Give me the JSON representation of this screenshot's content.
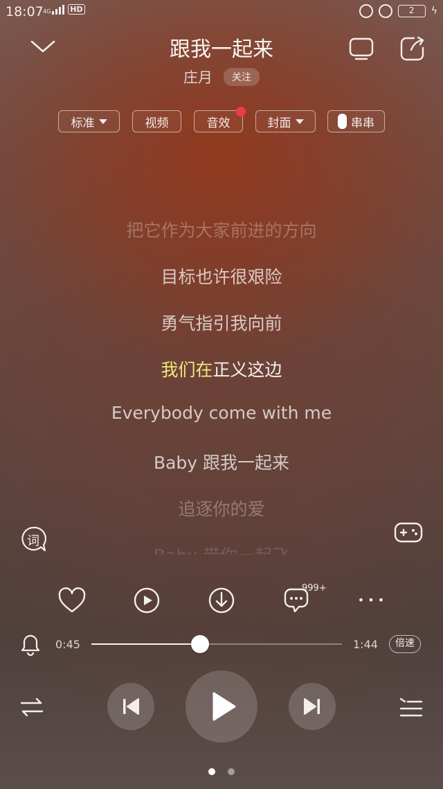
{
  "status_bar": {
    "time": "18:07",
    "network": "4G",
    "hd": "HD",
    "battery": "2"
  },
  "header": {
    "title": "跟我一起来",
    "artist": "庄月",
    "follow_label": "关注"
  },
  "chips": {
    "quality": "标准",
    "video": "视频",
    "effects": "音效",
    "cover": "封面",
    "chuan": "串串"
  },
  "lyrics": {
    "lines": [
      "把它作为大家前进的方向",
      "目标也许很艰险",
      "勇气指引我向前",
      "Everybody come with me",
      "Baby 跟我一起来",
      "追逐你的爱",
      "Baby 带你一起飞"
    ],
    "active_sung": "我们在",
    "active_rest": "正义这边"
  },
  "lyric_toggle_label": "词",
  "comments_badge": "999+",
  "more_label": "• • •",
  "progress": {
    "current": "0:45",
    "total": "1:44",
    "fraction": 0.433,
    "speed_label": "倍速"
  },
  "pagination": {
    "count": 2,
    "active": 0
  },
  "colors": {
    "highlight": "#f1e780",
    "badge_dot": "#f0394a"
  }
}
